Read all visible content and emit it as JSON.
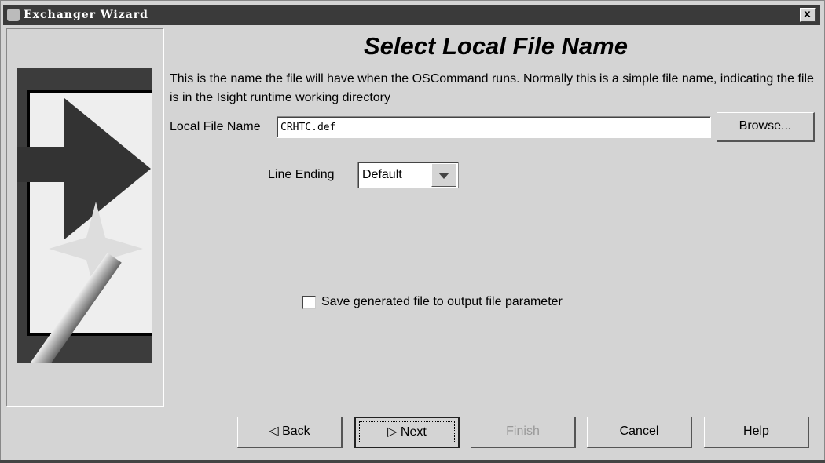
{
  "window": {
    "title": "Exchanger Wizard",
    "close": "x"
  },
  "heading": "Select Local File Name",
  "description": "This is the name the file will have when the OSCommand runs.  Normally this is a simple file name, indicating the file is in the Isight runtime working directory",
  "local_file": {
    "label": "Local File Name",
    "value": "CRHTC.def",
    "browse": "Browse..."
  },
  "line_ending": {
    "label": "Line Ending",
    "value": "Default"
  },
  "save_checkbox": {
    "label": "Save generated file to output file parameter",
    "checked": false
  },
  "buttons": {
    "back": "Back",
    "next": "Next",
    "finish": "Finish",
    "cancel": "Cancel",
    "help": "Help"
  }
}
